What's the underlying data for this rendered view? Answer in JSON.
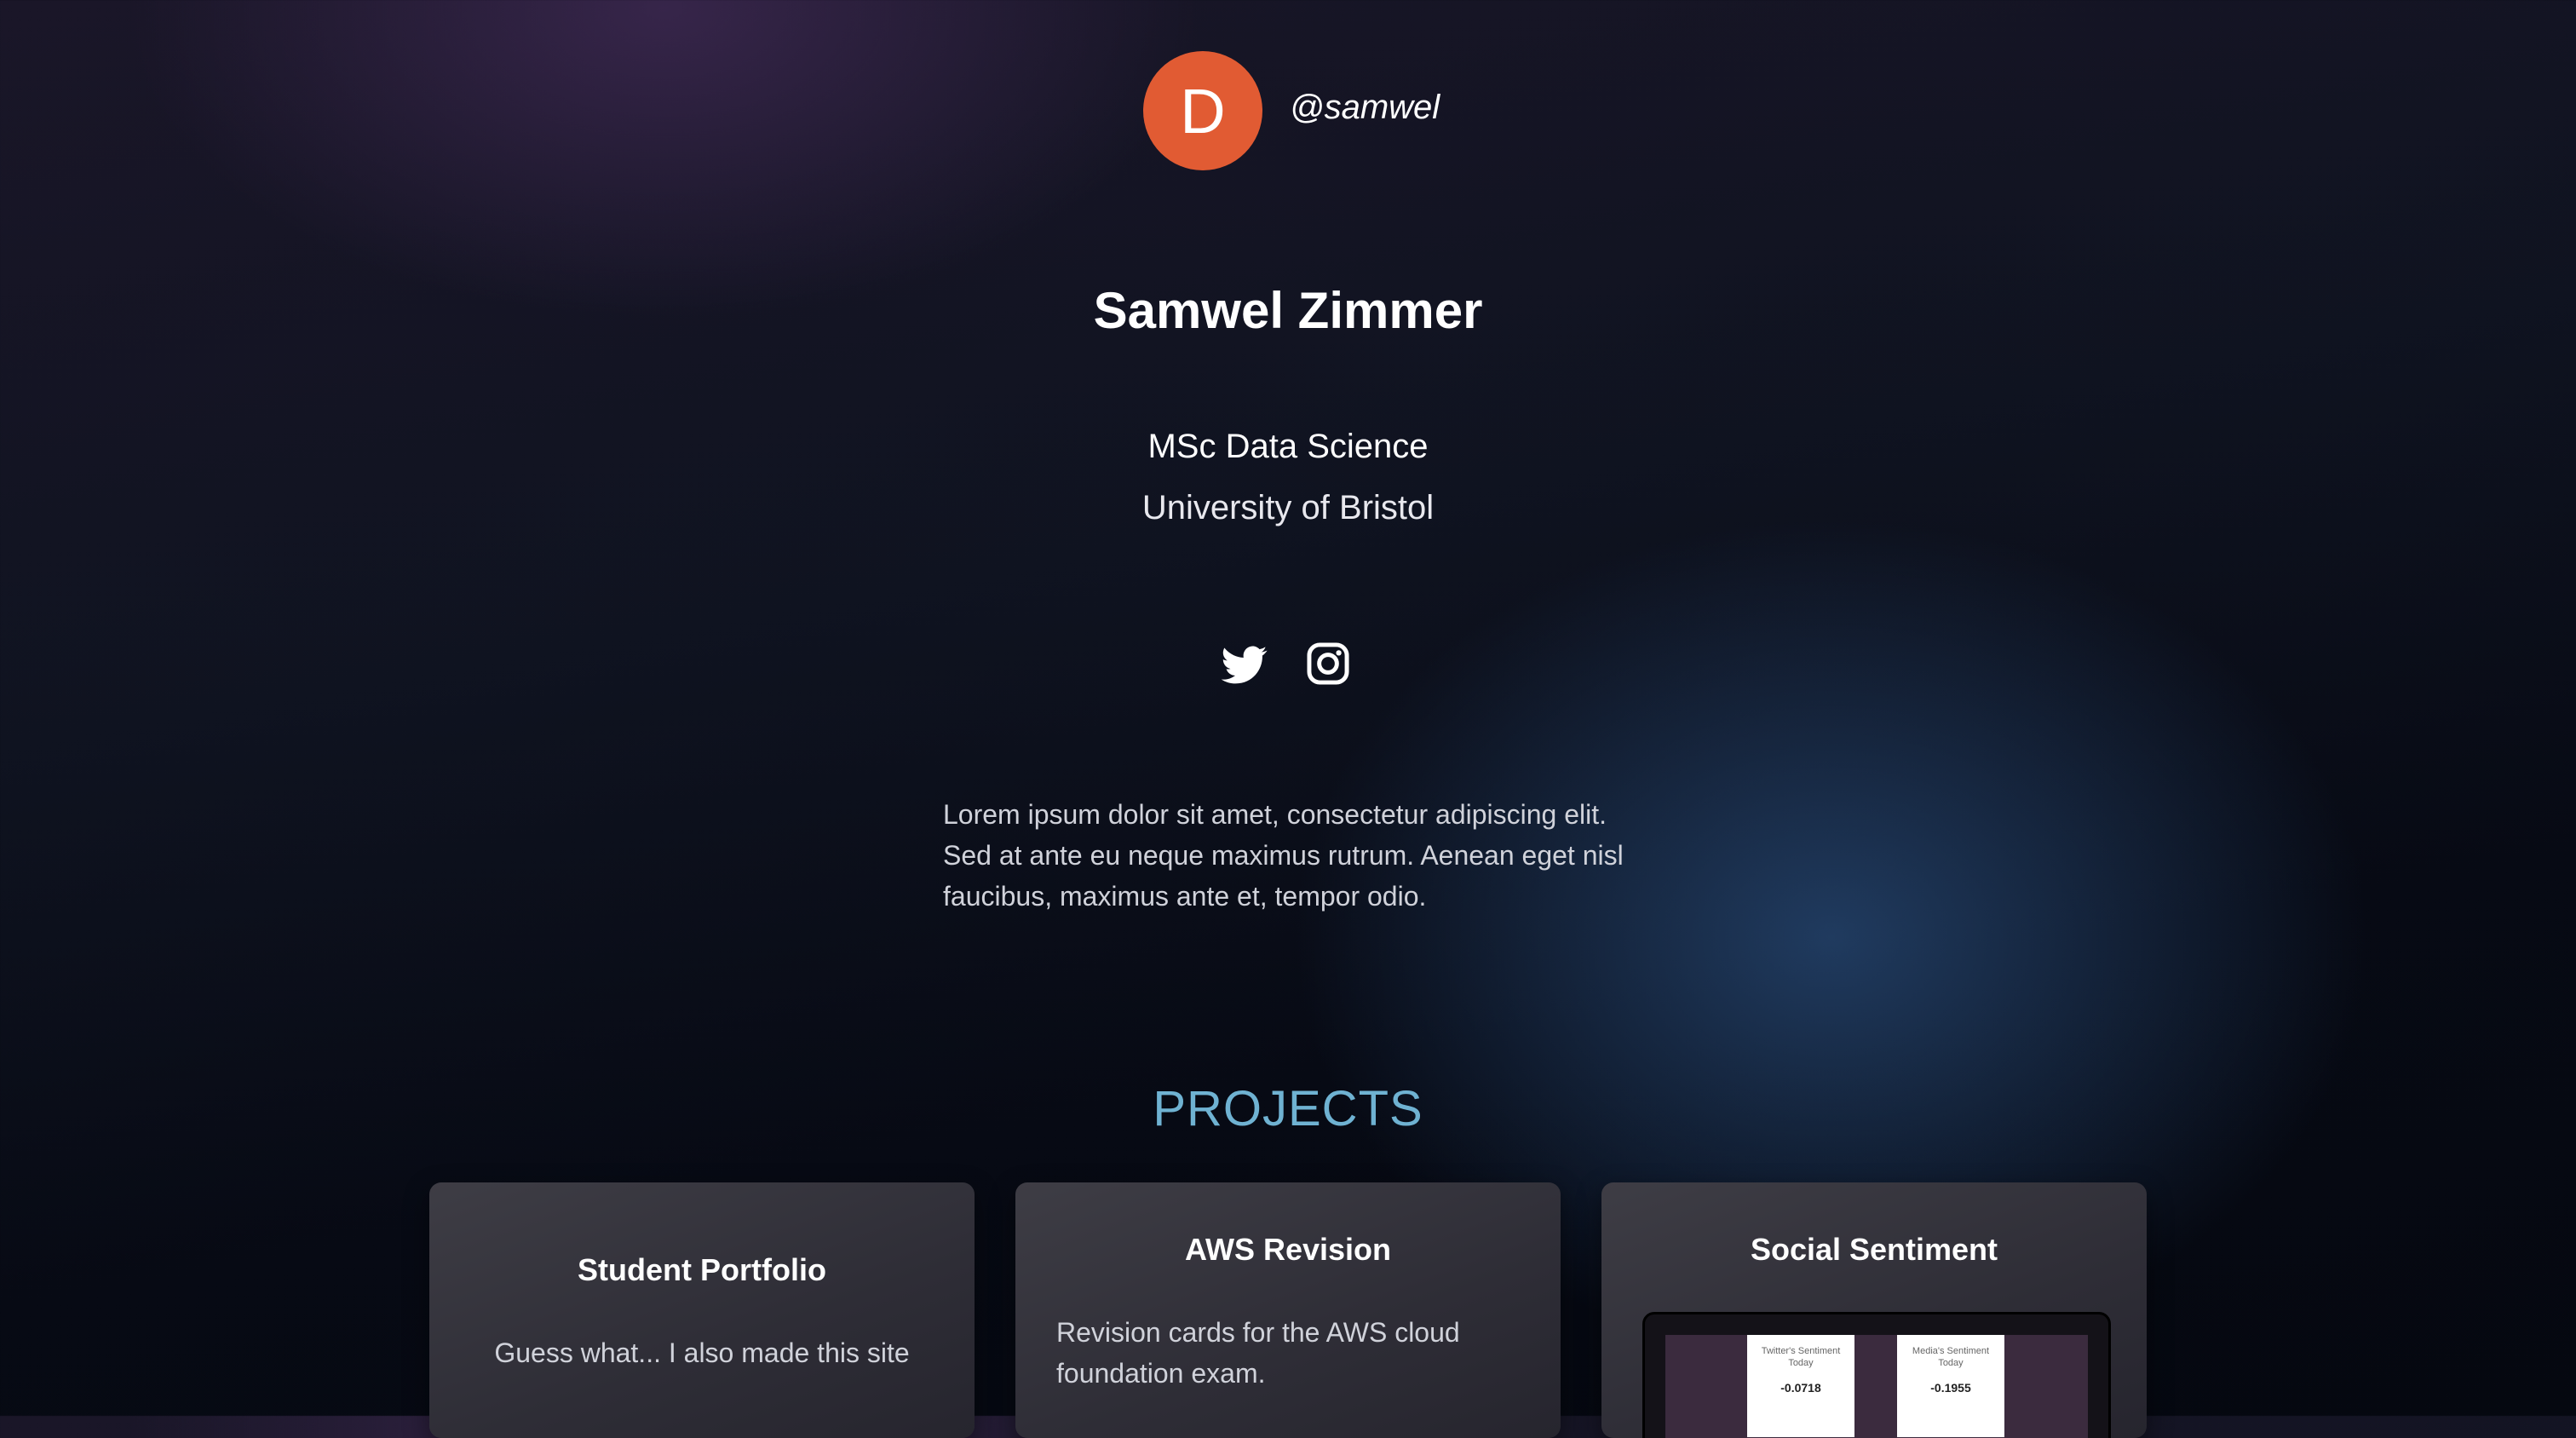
{
  "profile": {
    "avatar_initial": "D",
    "avatar_color": "#e15b33",
    "handle": "@samwel",
    "name": "Samwel Zimmer",
    "degree": "MSc Data Science",
    "university": "University of Bristol",
    "socials": [
      {
        "icon": "twitter-icon"
      },
      {
        "icon": "instagram-icon"
      }
    ],
    "bio": "Lorem ipsum dolor sit amet, consectetur adipiscing elit. Sed at ante eu neque maximus rutrum. Aenean eget nisl faucibus, maximus ante et, tempor odio."
  },
  "projects": {
    "title": "PROJECTS",
    "title_color": "#6fb2d2",
    "cards": [
      {
        "title": "Student Portfolio",
        "description": "Guess what... I also made this site"
      },
      {
        "title": "AWS Revision",
        "description": "Revision cards for the AWS cloud foundation exam."
      },
      {
        "title": "Social Sentiment",
        "preview": {
          "twitter_label": "Twitter's Sentiment Today",
          "twitter_value": "-0.0718",
          "media_label": "Media's Sentiment Today",
          "media_value": "-0.1955"
        }
      }
    ]
  }
}
